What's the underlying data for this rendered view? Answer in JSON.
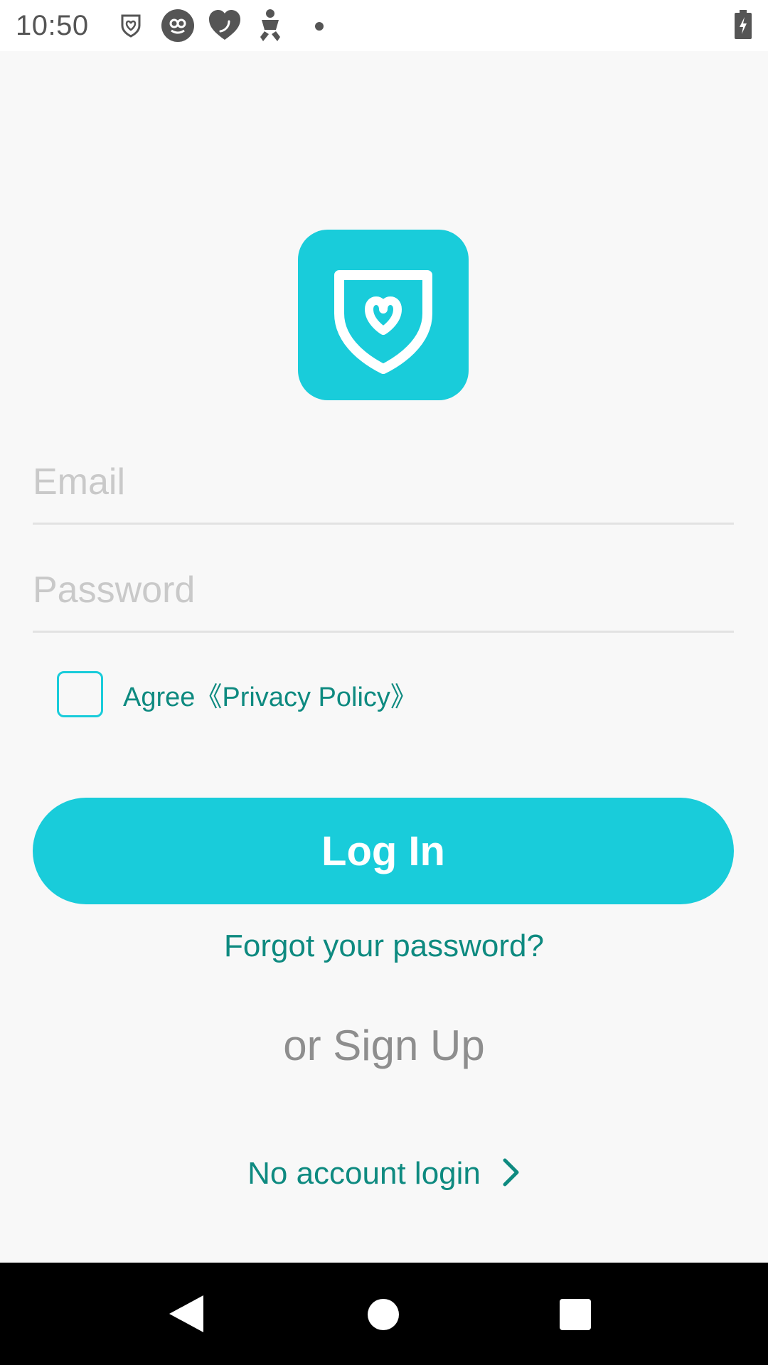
{
  "status_bar": {
    "time": "10:50",
    "icons": [
      "shield-heart-icon",
      "face-icon",
      "heart-phone-icon",
      "baby-icon",
      "dot-icon",
      "battery-charging-icon"
    ]
  },
  "logo": {
    "icon": "shield-heart-logo",
    "color": "#19ccda"
  },
  "form": {
    "email_placeholder": "Email",
    "password_placeholder": "Password",
    "agree_label": "Agree《Privacy Policy》",
    "agree_checked": false
  },
  "actions": {
    "login_label": "Log In",
    "forgot_label": "Forgot your password?",
    "signup_label": "or Sign Up",
    "no_account_label": "No account login"
  },
  "navigation": {
    "icons": [
      "back-icon",
      "home-icon",
      "recents-icon"
    ]
  },
  "colors": {
    "accent": "#19ccda",
    "link": "#0e8a80",
    "muted": "#8e8e8e",
    "background": "#f8f8f8"
  }
}
